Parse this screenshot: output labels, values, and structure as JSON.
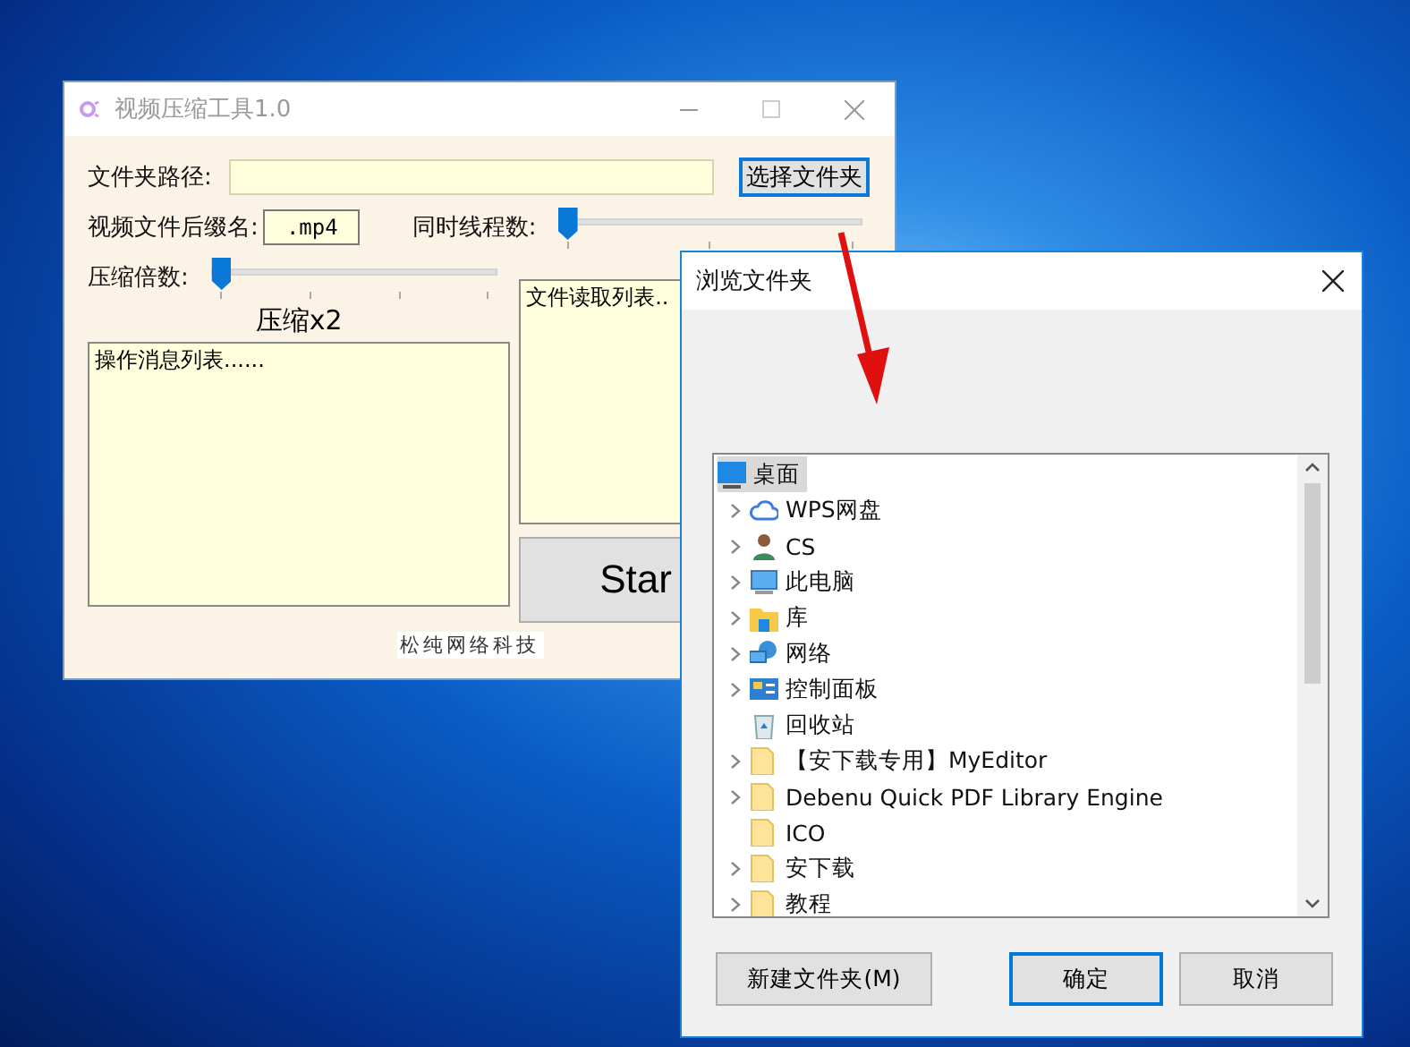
{
  "main_window": {
    "title": "视频压缩工具1.0",
    "folder_path": {
      "label": "文件夹路径:"
    },
    "choose_button": "选择文件夹",
    "suffix": {
      "label": "视频文件后缀名:",
      "value": ".mp4"
    },
    "threads": {
      "label": "同时线程数:",
      "level": 0
    },
    "compression": {
      "label": "压缩倍数:",
      "level": 0,
      "reading": "压缩x2"
    },
    "message_list": "操作消息列表......",
    "file_list": "文件读取列表..",
    "start_button": "Star",
    "footer": "松纯网络科技"
  },
  "dialog": {
    "title": "浏览文件夹",
    "tree": [
      {
        "label": "桌面",
        "kind": "desktop",
        "selected": true,
        "children": [
          {
            "label": "WPS网盘",
            "kind": "cloud",
            "expandable": true,
            "selected": false
          },
          {
            "label": "CS",
            "kind": "user",
            "expandable": true,
            "selected": false
          },
          {
            "label": "此电脑",
            "kind": "computer",
            "expandable": true,
            "selected": false
          },
          {
            "label": "库",
            "kind": "library",
            "expandable": true,
            "selected": false
          },
          {
            "label": "网络",
            "kind": "network",
            "expandable": true,
            "selected": false
          },
          {
            "label": "控制面板",
            "kind": "control-panel",
            "expandable": true,
            "selected": false
          },
          {
            "label": "回收站",
            "kind": "recycle-bin",
            "expandable": false,
            "selected": false
          },
          {
            "label": "【安下载专用】MyEditor",
            "kind": "folder",
            "expandable": true,
            "selected": false
          },
          {
            "label": "Debenu Quick PDF Library Engine",
            "kind": "folder",
            "expandable": true,
            "selected": false
          },
          {
            "label": "ICO",
            "kind": "folder",
            "expandable": false,
            "selected": false
          },
          {
            "label": "安下载",
            "kind": "folder",
            "expandable": true,
            "selected": false
          },
          {
            "label": "教程",
            "kind": "folder",
            "expandable": true,
            "selected": false
          }
        ]
      }
    ],
    "buttons": [
      {
        "label": "新建文件夹(M)",
        "focused": false
      },
      {
        "label": "确定",
        "focused": true
      },
      {
        "label": "取消",
        "focused": false
      }
    ]
  }
}
